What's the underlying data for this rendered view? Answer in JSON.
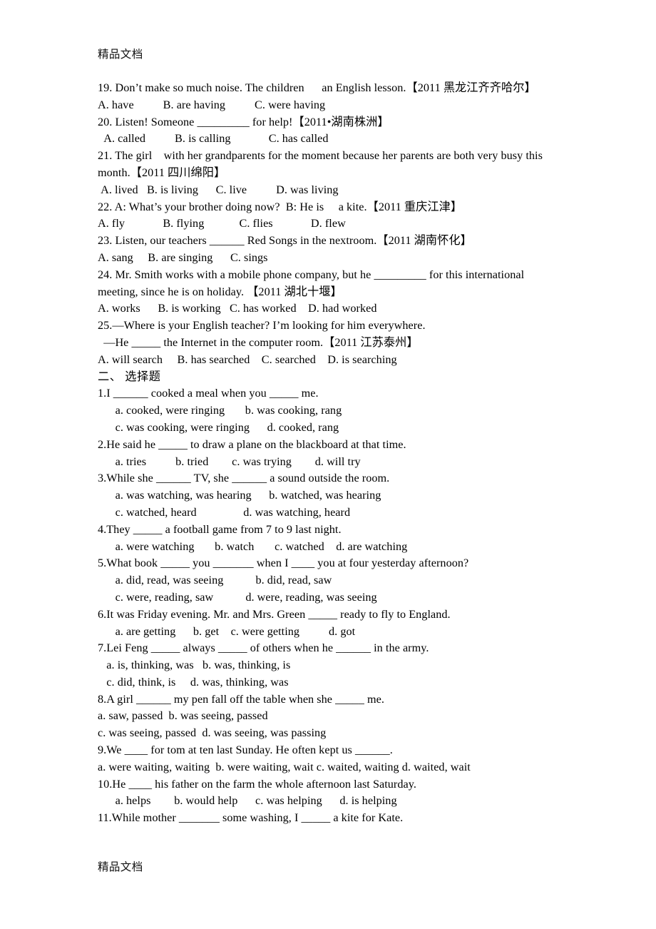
{
  "document": {
    "watermark_top": "精品文档",
    "watermark_bottom": "精品文档",
    "lines": [
      "19. Don’t make so much noise. The children      an English lesson.【2011 黑龙江齐齐哈尔】",
      "A. have          B. are having          C. were having",
      "20. Listen! Someone _________ for help!【2011•湖南株洲】",
      "  A. called          B. is calling             C. has called",
      "21. The girl    with her grandparents for the moment because her parents are both very busy this",
      "month.【2011 四川绵阳】",
      " A. lived   B. is living      C. live          D. was living",
      "22. A: What’s your brother doing now?  B: He is     a kite.【2011 重庆江津】",
      "A. fly             B. flying            C. flies             D. flew",
      "23. Listen, our teachers ______ Red Songs in the nextroom.【2011 湖南怀化】",
      "A. sang     B. are singing      C. sings",
      "24. Mr. Smith works with a mobile phone company, but he _________ for this international",
      "meeting, since he is on holiday. 【2011 湖北十堰】",
      "A. works      B. is working   C. has worked    D. had worked",
      "25.—Where is your English teacher? I’m looking for him everywhere.",
      "  —He _____ the Internet in the computer room.【2011 江苏泰州】",
      "A. will search     B. has searched    C. searched    D. is searching",
      "二、 选择题",
      "1.I ______ cooked a meal when you _____ me.",
      "      a. cooked, were ringing       b. was cooking, rang",
      "      c. was cooking, were ringing      d. cooked, rang",
      "2.He said he _____ to draw a plane on the blackboard at that time.",
      "      a. tries          b. tried        c. was trying        d. will try",
      "3.While she ______ TV, she ______ a sound outside the room.",
      "      a. was watching, was hearing      b. watched, was hearing",
      "      c. watched, heard                d. was watching, heard",
      "4.They _____ a football game from 7 to 9 last night.",
      "      a. were watching       b. watch       c. watched    d. are watching",
      "5.What book _____ you _______ when I ____ you at four yesterday afternoon?",
      "      a. did, read, was seeing           b. did, read, saw",
      "      c. were, reading, saw           d. were, reading, was seeing",
      "6.It was Friday evening. Mr. and Mrs. Green _____ ready to fly to England.",
      "      a. are getting      b. get    c. were getting          d. got",
      "7.Lei Feng _____ always _____ of others when he ______ in the army.",
      "   a. is, thinking, was   b. was, thinking, is",
      "   c. did, think, is     d. was, thinking, was",
      "8.A girl ______ my pen fall off the table when she _____ me.",
      "a. saw, passed  b. was seeing, passed",
      "c. was seeing, passed  d. was seeing, was passing",
      "9.We ____ for tom at ten last Sunday. He often kept us ______.",
      "a. were waiting, waiting  b. were waiting, wait c. waited, waiting d. waited, wait",
      "10.He ____ his father on the farm the whole afternoon last Saturday.",
      "      a. helps        b. would help      c. was helping      d. is helping",
      "11.While mother _______ some washing, I _____ a kite for Kate."
    ]
  }
}
